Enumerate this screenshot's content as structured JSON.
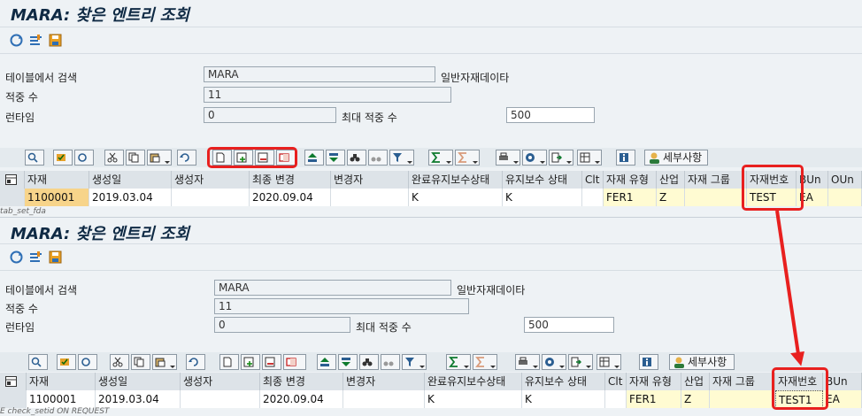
{
  "top": {
    "title": "MARA: 찾은 엔트리 조회",
    "search": {
      "table_label": "테이블에서 검색",
      "table_value": "MARA",
      "table_desc": "일반자재데이타",
      "hits_label": "적중 수",
      "hits_value": "11",
      "runtime_label": "런타임",
      "runtime_value": "0",
      "max_hits_label": "최대 적중 수",
      "max_hits_value": "500"
    },
    "toolbar": {
      "details_label": "세부사항"
    },
    "columns": [
      "자재",
      "생성일",
      "생성자",
      "최종 변경",
      "변경자",
      "완료유지보수상태",
      "유지보수 상태",
      "Clt",
      "자재 유형",
      "산업",
      "자재 그룹",
      "자재번호",
      "BUn",
      "OUn"
    ],
    "row": [
      "1100001",
      "2019.03.04",
      "",
      "2020.09.04",
      "",
      "K",
      "K",
      "",
      "FER1",
      "Z",
      "",
      "TEST",
      "EA",
      ""
    ],
    "status_text": "tab_set_fda"
  },
  "bottom": {
    "title": "MARA: 찾은 엔트리 조회",
    "search": {
      "table_label": "테이블에서 검색",
      "table_value": "MARA",
      "table_desc": "일반자재데이타",
      "hits_label": "적중 수",
      "hits_value": "11",
      "runtime_label": "런타임",
      "runtime_value": "0",
      "max_hits_label": "최대 적중 수",
      "max_hits_value": "500"
    },
    "toolbar": {
      "details_label": "세부사항"
    },
    "columns": [
      "자재",
      "생성일",
      "생성자",
      "최종 변경",
      "변경자",
      "완료유지보수상태",
      "유지보수 상태",
      "Clt",
      "자재 유형",
      "산업",
      "자재 그룹",
      "자재번호",
      "BUn"
    ],
    "row": [
      "1100001",
      "2019.03.04",
      "",
      "2020.09.04",
      "",
      "K",
      "K",
      "",
      "FER1",
      "Z",
      "",
      "TEST1",
      "EA"
    ],
    "status_text": "E check_setid ON REQUEST"
  },
  "colors": {
    "highlight": "#e8201f",
    "sap_bg": "#eef2f5",
    "title": "#0f2a44"
  }
}
